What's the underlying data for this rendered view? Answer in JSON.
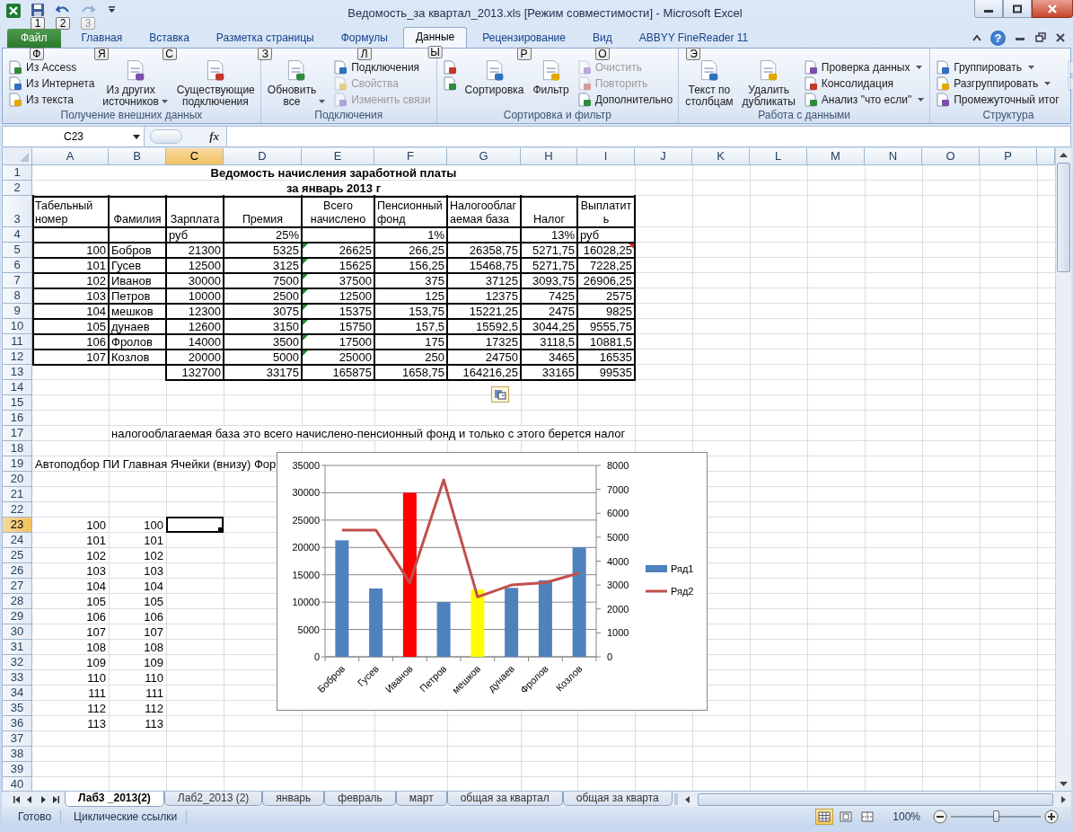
{
  "title_bar": {
    "title": "Ведомость_за квартал_2013.xls  [Режим совместимости]  -  Microsoft Excel",
    "quick_access": [
      {
        "kind": "save",
        "keytip": "1",
        "disabled": false
      },
      {
        "kind": "undo",
        "keytip": "2",
        "disabled": false
      },
      {
        "kind": "redo",
        "keytip": "3",
        "disabled": true
      }
    ]
  },
  "tabs": [
    {
      "label": "Файл",
      "keytip": "Ф",
      "selected": false,
      "kind": "file"
    },
    {
      "label": "Главная",
      "keytip": "Я",
      "selected": false,
      "kind": "tab"
    },
    {
      "label": "Вставка",
      "keytip": "С",
      "selected": false,
      "kind": "tab"
    },
    {
      "label": "Разметка страницы",
      "keytip": "З",
      "selected": false,
      "kind": "tab"
    },
    {
      "label": "Формулы",
      "keytip": "Л",
      "selected": false,
      "kind": "tab"
    },
    {
      "label": "Данные",
      "keytip": "Ы",
      "selected": true,
      "kind": "tab"
    },
    {
      "label": "Рецензирование",
      "keytip": "Р",
      "selected": false,
      "kind": "tab"
    },
    {
      "label": "Вид",
      "keytip": "О",
      "selected": false,
      "kind": "tab"
    },
    {
      "label": "ABBYY FineReader 11",
      "keytip": "Э",
      "selected": false,
      "kind": "tab"
    }
  ],
  "help_button": "?",
  "ribbon": {
    "groups": [
      {
        "label": "Получение внешних данных",
        "launcher": false,
        "columns": [
          {
            "kind": "stack",
            "items": [
              {
                "label": "Из Access",
                "disabled": false,
                "dropdown": false
              },
              {
                "label": "Из Интернета",
                "disabled": false,
                "dropdown": false
              },
              {
                "label": "Из текста",
                "disabled": false,
                "dropdown": false
              }
            ]
          },
          {
            "kind": "large",
            "label": "Из других источников",
            "disabled": false,
            "dropdown": true
          },
          {
            "kind": "large",
            "label": "Существующие подключения",
            "disabled": false,
            "dropdown": false
          }
        ]
      },
      {
        "label": "Подключения",
        "launcher": false,
        "columns": [
          {
            "kind": "large",
            "label": "Обновить все",
            "disabled": false,
            "dropdown": true
          },
          {
            "kind": "stack",
            "items": [
              {
                "label": "Подключения",
                "disabled": false,
                "dropdown": false
              },
              {
                "label": "Свойства",
                "disabled": true,
                "dropdown": false
              },
              {
                "label": "Изменить связи",
                "disabled": true,
                "dropdown": false
              }
            ]
          }
        ]
      },
      {
        "label": "Сортировка и фильтр",
        "launcher": false,
        "columns": [
          {
            "kind": "stack",
            "items": [
              {
                "disabled": false,
                "dropdown": false
              },
              {
                "disabled": false,
                "dropdown": false
              }
            ]
          },
          {
            "kind": "large",
            "label": "Сортировка",
            "disabled": false,
            "dropdown": false
          },
          {
            "kind": "large",
            "label": "Фильтр",
            "disabled": false,
            "dropdown": false
          },
          {
            "kind": "stack",
            "items": [
              {
                "label": "Очистить",
                "disabled": true,
                "dropdown": false
              },
              {
                "label": "Повторить",
                "disabled": true,
                "dropdown": false
              },
              {
                "label": "Дополнительно",
                "disabled": false,
                "dropdown": false
              }
            ]
          }
        ]
      },
      {
        "label": "Работа с данными",
        "launcher": false,
        "columns": [
          {
            "kind": "large",
            "label": "Текст по столбцам",
            "disabled": false,
            "dropdown": false
          },
          {
            "kind": "large",
            "label": "Удалить дубликаты",
            "disabled": false,
            "dropdown": false
          },
          {
            "kind": "stack",
            "items": [
              {
                "label": "Проверка данных",
                "disabled": false,
                "dropdown": true
              },
              {
                "label": "Консолидация",
                "disabled": false,
                "dropdown": false
              },
              {
                "label": "Анализ \"что если\"",
                "disabled": false,
                "dropdown": true
              }
            ]
          }
        ]
      },
      {
        "label": "Структура",
        "launcher": true,
        "columns": [
          {
            "kind": "stack",
            "items": [
              {
                "label": "Группировать",
                "disabled": false,
                "dropdown": true
              },
              {
                "label": "Разгруппировать",
                "disabled": false,
                "dropdown": true
              },
              {
                "label": "Промежуточный итог",
                "disabled": false,
                "dropdown": false
              }
            ]
          },
          {
            "kind": "stack",
            "items": [
              {
                "disabled": true,
                "dropdown": false
              },
              {
                "disabled": true,
                "dropdown": false
              }
            ]
          }
        ]
      }
    ]
  },
  "formula_bar": {
    "name_box": "C23",
    "function_button": "fx"
  },
  "sheet": {
    "columns": [
      {
        "label": "A",
        "selected": false
      },
      {
        "label": "B",
        "selected": false
      },
      {
        "label": "C",
        "selected": true
      },
      {
        "label": "D",
        "selected": false
      },
      {
        "label": "E",
        "selected": false
      },
      {
        "label": "F",
        "selected": false
      },
      {
        "label": "G",
        "selected": false
      },
      {
        "label": "H",
        "selected": false
      },
      {
        "label": "I",
        "selected": false
      },
      {
        "label": "J",
        "selected": false
      },
      {
        "label": "K",
        "selected": false
      },
      {
        "label": "L",
        "selected": false
      },
      {
        "label": "M",
        "selected": false
      },
      {
        "label": "N",
        "selected": false
      },
      {
        "label": "O",
        "selected": false
      },
      {
        "label": "P",
        "selected": false
      }
    ],
    "rows": [
      {
        "number": "1",
        "selected": false,
        "kind": "title",
        "cells": {
          "A": {
            "text": "Ведомость начисления заработной платы",
            "kind": "title"
          }
        }
      },
      {
        "number": "2",
        "selected": false,
        "kind": "title",
        "cells": {
          "A": {
            "text": "за январь 2013 г",
            "kind": "title"
          }
        }
      },
      {
        "number": "3",
        "selected": false,
        "kind": "header",
        "cells": {
          "A": {
            "text": "Табельный номер",
            "kind": "text"
          },
          "B": {
            "text": "Фамилия",
            "kind": "heading"
          },
          "C": {
            "text": "Зарплата",
            "kind": "heading"
          },
          "D": {
            "text": "Премия",
            "kind": "heading"
          },
          "E": {
            "text": "Всего начислено",
            "kind": "heading"
          },
          "F": {
            "text": "Пенсионный фонд",
            "kind": "text"
          },
          "G": {
            "text": "Налогооблагаемая база",
            "kind": "text"
          },
          "H": {
            "text": "Налог",
            "kind": "heading"
          },
          "I": {
            "text": "Выплатить",
            "kind": "heading"
          }
        }
      },
      {
        "number": "4",
        "selected": false,
        "kind": "data",
        "cells": {
          "C": {
            "text": "руб",
            "kind": "text"
          },
          "D": {
            "text": "25%",
            "kind": "number"
          },
          "F": {
            "text": "1%",
            "kind": "number"
          },
          "H": {
            "text": "13%",
            "kind": "number"
          },
          "I": {
            "text": "руб",
            "kind": "text"
          }
        }
      },
      {
        "number": "5",
        "selected": false,
        "kind": "data",
        "cells": {
          "A": {
            "text": "100",
            "kind": "number"
          },
          "B": {
            "text": "Бобров",
            "kind": "text"
          },
          "C": {
            "text": "21300",
            "kind": "number"
          },
          "D": {
            "text": "5325",
            "kind": "number"
          },
          "E": {
            "text": "26625",
            "kind": "number",
            "error_flag": true
          },
          "F": {
            "text": "266,25",
            "kind": "number"
          },
          "G": {
            "text": "26358,75",
            "kind": "number"
          },
          "H": {
            "text": "5271,75",
            "kind": "number"
          },
          "I": {
            "text": "16028,25",
            "kind": "number",
            "comment": true
          }
        }
      },
      {
        "number": "6",
        "selected": false,
        "kind": "data",
        "cells": {
          "A": {
            "text": "101",
            "kind": "number"
          },
          "B": {
            "text": "Гусев",
            "kind": "text"
          },
          "C": {
            "text": "12500",
            "kind": "number"
          },
          "D": {
            "text": "3125",
            "kind": "number"
          },
          "E": {
            "text": "15625",
            "kind": "number",
            "error_flag": true
          },
          "F": {
            "text": "156,25",
            "kind": "number"
          },
          "G": {
            "text": "15468,75",
            "kind": "number"
          },
          "H": {
            "text": "5271,75",
            "kind": "number"
          },
          "I": {
            "text": "7228,25",
            "kind": "number"
          }
        }
      },
      {
        "number": "7",
        "selected": false,
        "kind": "data",
        "cells": {
          "A": {
            "text": "102",
            "kind": "number"
          },
          "B": {
            "text": "Иванов",
            "kind": "text"
          },
          "C": {
            "text": "30000",
            "kind": "number"
          },
          "D": {
            "text": "7500",
            "kind": "number"
          },
          "E": {
            "text": "37500",
            "kind": "number",
            "error_flag": true
          },
          "F": {
            "text": "375",
            "kind": "number"
          },
          "G": {
            "text": "37125",
            "kind": "number"
          },
          "H": {
            "text": "3093,75",
            "kind": "number"
          },
          "I": {
            "text": "26906,25",
            "kind": "number"
          }
        }
      },
      {
        "number": "8",
        "selected": false,
        "kind": "data",
        "cells": {
          "A": {
            "text": "103",
            "kind": "number"
          },
          "B": {
            "text": "Петров",
            "kind": "text"
          },
          "C": {
            "text": "10000",
            "kind": "number"
          },
          "D": {
            "text": "2500",
            "kind": "number"
          },
          "E": {
            "text": "12500",
            "kind": "number",
            "error_flag": true
          },
          "F": {
            "text": "125",
            "kind": "number"
          },
          "G": {
            "text": "12375",
            "kind": "number"
          },
          "H": {
            "text": "7425",
            "kind": "number"
          },
          "I": {
            "text": "2575",
            "kind": "number"
          }
        }
      },
      {
        "number": "9",
        "selected": false,
        "kind": "data",
        "cells": {
          "A": {
            "text": "104",
            "kind": "number"
          },
          "B": {
            "text": "мешков",
            "kind": "text"
          },
          "C": {
            "text": "12300",
            "kind": "number"
          },
          "D": {
            "text": "3075",
            "kind": "number"
          },
          "E": {
            "text": "15375",
            "kind": "number",
            "error_flag": true
          },
          "F": {
            "text": "153,75",
            "kind": "number"
          },
          "G": {
            "text": "15221,25",
            "kind": "number"
          },
          "H": {
            "text": "2475",
            "kind": "number"
          },
          "I": {
            "text": "9825",
            "kind": "number"
          }
        }
      },
      {
        "number": "10",
        "selected": false,
        "kind": "data",
        "cells": {
          "A": {
            "text": "105",
            "kind": "number"
          },
          "B": {
            "text": "дунаев",
            "kind": "text"
          },
          "C": {
            "text": "12600",
            "kind": "number"
          },
          "D": {
            "text": "3150",
            "kind": "number"
          },
          "E": {
            "text": "15750",
            "kind": "number",
            "error_flag": true
          },
          "F": {
            "text": "157,5",
            "kind": "number"
          },
          "G": {
            "text": "15592,5",
            "kind": "number"
          },
          "H": {
            "text": "3044,25",
            "kind": "number"
          },
          "I": {
            "text": "9555,75",
            "kind": "number"
          }
        }
      },
      {
        "number": "11",
        "selected": false,
        "kind": "data",
        "cells": {
          "A": {
            "text": "106",
            "kind": "number"
          },
          "B": {
            "text": "Фролов",
            "kind": "text"
          },
          "C": {
            "text": "14000",
            "kind": "number"
          },
          "D": {
            "text": "3500",
            "kind": "number"
          },
          "E": {
            "text": "17500",
            "kind": "number",
            "error_flag": true
          },
          "F": {
            "text": "175",
            "kind": "number"
          },
          "G": {
            "text": "17325",
            "kind": "number"
          },
          "H": {
            "text": "3118,5",
            "kind": "number"
          },
          "I": {
            "text": "10881,5",
            "kind": "number"
          }
        }
      },
      {
        "number": "12",
        "selected": false,
        "kind": "data",
        "cells": {
          "A": {
            "text": "107",
            "kind": "number"
          },
          "B": {
            "text": "Козлов",
            "kind": "text"
          },
          "C": {
            "text": "20000",
            "kind": "number"
          },
          "D": {
            "text": "5000",
            "kind": "number"
          },
          "E": {
            "text": "25000",
            "kind": "number",
            "error_flag": true
          },
          "F": {
            "text": "250",
            "kind": "number"
          },
          "G": {
            "text": "24750",
            "kind": "number"
          },
          "H": {
            "text": "3465",
            "kind": "number"
          },
          "I": {
            "text": "16535",
            "kind": "number"
          }
        }
      },
      {
        "number": "13",
        "selected": false,
        "kind": "total",
        "cells": {
          "C": {
            "text": "132700",
            "kind": "number"
          },
          "D": {
            "text": "33175",
            "kind": "number"
          },
          "E": {
            "text": "165875",
            "kind": "number"
          },
          "F": {
            "text": "1658,75",
            "kind": "number"
          },
          "G": {
            "text": "164216,25",
            "kind": "number"
          },
          "H": {
            "text": "33165",
            "kind": "number"
          },
          "I": {
            "text": "99535",
            "kind": "number"
          }
        }
      },
      {
        "number": "14",
        "selected": false,
        "kind": "plain"
      },
      {
        "number": "15",
        "selected": false,
        "kind": "plain"
      },
      {
        "number": "16",
        "selected": false,
        "kind": "plain"
      },
      {
        "number": "17",
        "selected": false,
        "kind": "plain",
        "cells": {
          "B": {
            "text": "налогооблагаемая база это всего начислено-пенсионный фонд и только с этого берется налог",
            "kind": "text"
          }
        }
      },
      {
        "number": "18",
        "selected": false,
        "kind": "plain"
      },
      {
        "number": "19",
        "selected": false,
        "kind": "plain",
        "cells": {
          "A": {
            "text": "Автоподбор ПИ Главная Ячейки (внизу) Фор",
            "kind": "text"
          }
        }
      },
      {
        "number": "20",
        "selected": false,
        "kind": "plain"
      },
      {
        "number": "21",
        "selected": false,
        "kind": "plain"
      },
      {
        "number": "22",
        "selected": false,
        "kind": "plain"
      },
      {
        "number": "23",
        "selected": true,
        "kind": "plain",
        "cells": {
          "A": {
            "text": "100",
            "kind": "number"
          },
          "B": {
            "text": "100",
            "kind": "number"
          }
        }
      },
      {
        "number": "24",
        "selected": false,
        "kind": "plain",
        "cells": {
          "A": {
            "text": "101",
            "kind": "number"
          },
          "B": {
            "text": "101",
            "kind": "number"
          }
        }
      },
      {
        "number": "25",
        "selected": false,
        "kind": "plain",
        "cells": {
          "A": {
            "text": "102",
            "kind": "number"
          },
          "B": {
            "text": "102",
            "kind": "number"
          }
        }
      },
      {
        "number": "26",
        "selected": false,
        "kind": "plain",
        "cells": {
          "A": {
            "text": "103",
            "kind": "number"
          },
          "B": {
            "text": "103",
            "kind": "number"
          }
        }
      },
      {
        "number": "27",
        "selected": false,
        "kind": "plain",
        "cells": {
          "A": {
            "text": "104",
            "kind": "number"
          },
          "B": {
            "text": "104",
            "kind": "number"
          }
        }
      },
      {
        "number": "28",
        "selected": false,
        "kind": "plain",
        "cells": {
          "A": {
            "text": "105",
            "kind": "number"
          },
          "B": {
            "text": "105",
            "kind": "number"
          }
        }
      },
      {
        "number": "29",
        "selected": false,
        "kind": "plain",
        "cells": {
          "A": {
            "text": "106",
            "kind": "number"
          },
          "B": {
            "text": "106",
            "kind": "number"
          }
        }
      },
      {
        "number": "30",
        "selected": false,
        "kind": "plain",
        "cells": {
          "A": {
            "text": "107",
            "kind": "number"
          },
          "B": {
            "text": "107",
            "kind": "number"
          }
        }
      },
      {
        "number": "31",
        "selected": false,
        "kind": "plain",
        "cells": {
          "A": {
            "text": "108",
            "kind": "number"
          },
          "B": {
            "text": "108",
            "kind": "number"
          }
        }
      },
      {
        "number": "32",
        "selected": false,
        "kind": "plain",
        "cells": {
          "A": {
            "text": "109",
            "kind": "number"
          },
          "B": {
            "text": "109",
            "kind": "number"
          }
        }
      },
      {
        "number": "33",
        "selected": false,
        "kind": "plain",
        "cells": {
          "A": {
            "text": "110",
            "kind": "number"
          },
          "B": {
            "text": "110",
            "kind": "number"
          }
        }
      },
      {
        "number": "34",
        "selected": false,
        "kind": "plain",
        "cells": {
          "A": {
            "text": "111",
            "kind": "number"
          },
          "B": {
            "text": "111",
            "kind": "number"
          }
        }
      },
      {
        "number": "35",
        "selected": false,
        "kind": "plain",
        "cells": {
          "A": {
            "text": "112",
            "kind": "number"
          },
          "B": {
            "text": "112",
            "kind": "number"
          }
        }
      },
      {
        "number": "36",
        "selected": false,
        "kind": "plain",
        "cells": {
          "A": {
            "text": "113",
            "kind": "number"
          },
          "B": {
            "text": "113",
            "kind": "number"
          }
        }
      },
      {
        "number": "37",
        "selected": false,
        "kind": "plain"
      },
      {
        "number": "38",
        "selected": false,
        "kind": "plain"
      },
      {
        "number": "39",
        "selected": false,
        "kind": "plain"
      },
      {
        "number": "40",
        "selected": false,
        "kind": "plain"
      }
    ],
    "chart": {
      "chart_data": {
        "type": "bar",
        "categories": [
          "Бобров",
          "Гусев",
          "Иванов",
          "Петров",
          "мешков",
          "дунаев",
          "Фролов",
          "Козлов"
        ],
        "series": [
          {
            "name": "Ряд1",
            "type": "bar",
            "color": "#4f81bd",
            "colors": [
              "#4f81bd",
              "#4f81bd",
              "#ff0000",
              "#4f81bd",
              "#ffff00",
              "#4f81bd",
              "#4f81bd",
              "#4f81bd"
            ],
            "values": [
              21300,
              12500,
              30000,
              10000,
              12300,
              12600,
              14000,
              20000
            ]
          },
          {
            "name": "Ряд2",
            "type": "line",
            "axis": "y2",
            "color": "#c0504d",
            "values": [
              5300,
              5300,
              3100,
              7400,
              2500,
              3000,
              3100,
              3500
            ]
          }
        ],
        "ylim": [
          0,
          35000
        ],
        "yticks": [
          0,
          5000,
          10000,
          15000,
          20000,
          25000,
          30000,
          35000
        ],
        "y2lim": [
          0,
          8000
        ],
        "y2ticks": [
          0,
          1000,
          2000,
          3000,
          4000,
          5000,
          6000,
          7000,
          8000
        ],
        "grid": true,
        "legend": "right"
      }
    }
  },
  "sheet_tabs": [
    {
      "label": "Лаб3 _2013(2)",
      "selected": true
    },
    {
      "label": "Лаб2_2013 (2)",
      "selected": false
    },
    {
      "label": "январь",
      "selected": false
    },
    {
      "label": "февраль",
      "selected": false
    },
    {
      "label": "март",
      "selected": false
    },
    {
      "label": "общая за квартал",
      "selected": false
    },
    {
      "label": "общая за кварта",
      "selected": false
    }
  ],
  "status_bar": {
    "items": [
      "Готово",
      "Циклические ссылки"
    ],
    "views": [
      {
        "selected": true
      },
      {
        "selected": false
      },
      {
        "selected": false
      }
    ],
    "zoom": "100%",
    "zoom_slider": {
      "level": 0.5
    }
  }
}
